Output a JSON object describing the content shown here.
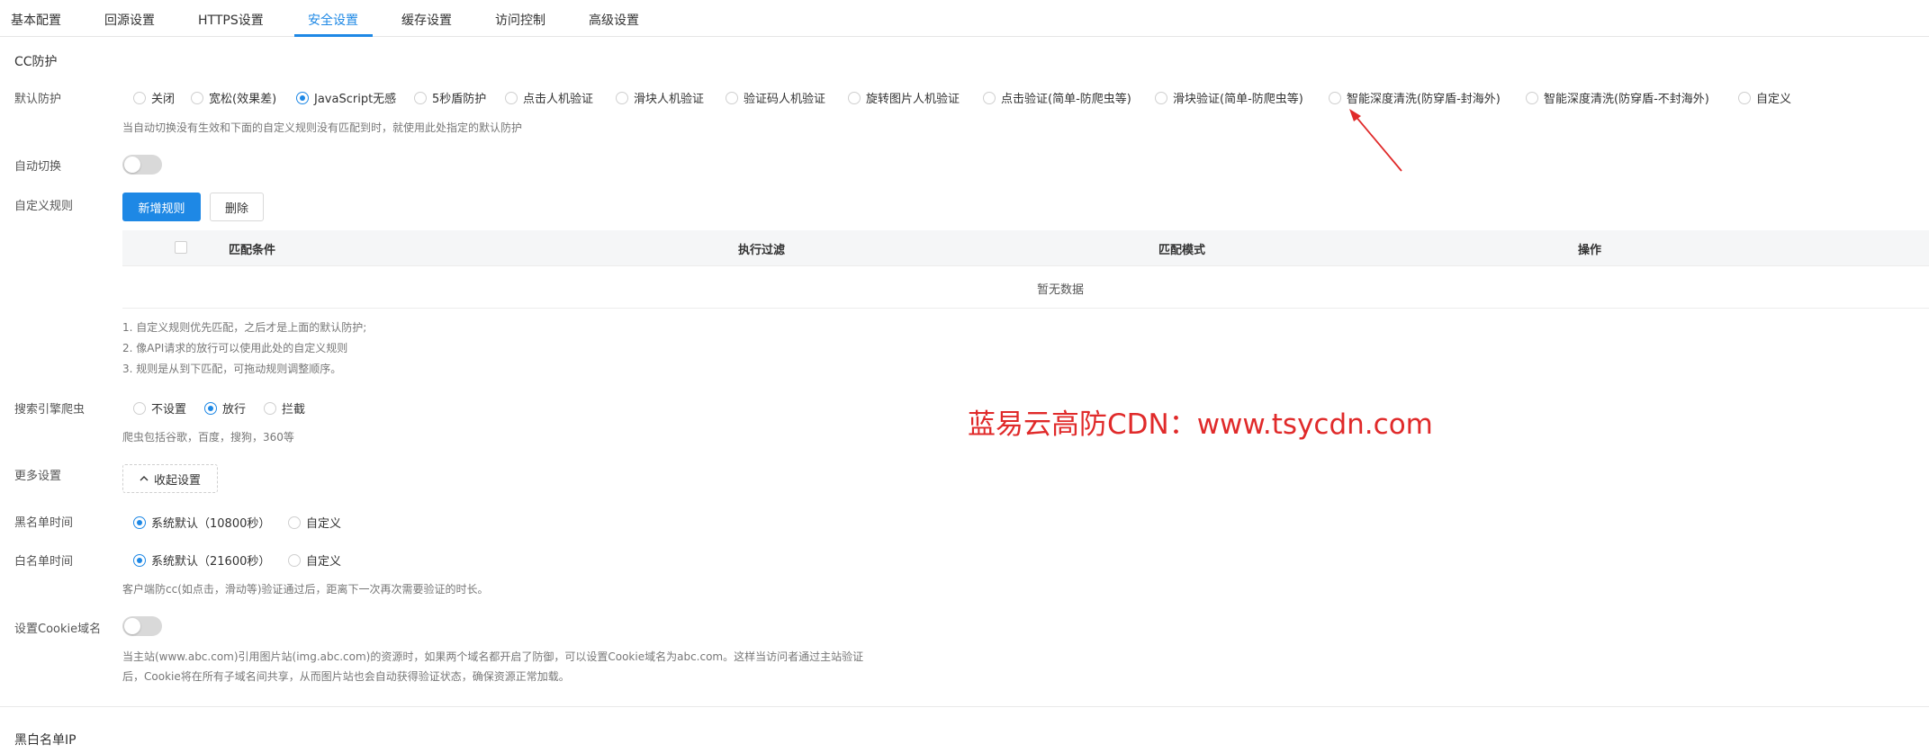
{
  "tabs": [
    "基本配置",
    "回源设置",
    "HTTPS设置",
    "安全设置",
    "缓存设置",
    "访问控制",
    "高级设置"
  ],
  "cc": {
    "title": "CC防护",
    "default_label": "默认防护",
    "default_options": [
      "关闭",
      "宽松(效果差)",
      "JavaScript无感",
      "5秒盾防护",
      "点击人机验证",
      "滑块人机验证",
      "验证码人机验证",
      "旋转图片人机验证",
      "点击验证(简单-防爬虫等)",
      "滑块验证(简单-防爬虫等)",
      "智能深度清洗(防穿盾-封海外)",
      "智能深度清洗(防穿盾-不封海外)",
      "自定义"
    ],
    "default_selected": "JavaScript无感",
    "default_help": "当自动切换没有生效和下面的自定义规则没有匹配到时，就使用此处指定的默认防护",
    "auto_switch_label": "自动切换",
    "custom_rules_label": "自定义规则",
    "add_rule_button": "新增规则",
    "delete_button": "删除",
    "table_headers": [
      "匹配条件",
      "执行过滤",
      "匹配模式",
      "操作"
    ],
    "table_empty": "暂无数据",
    "rules_notes": [
      "1. 自定义规则优先匹配，之后才是上面的默认防护;",
      "2. 像API请求的放行可以使用此处的自定义规则",
      "3. 规则是从到下匹配，可拖动规则调整顺序。"
    ],
    "crawler_label": "搜索引擎爬虫",
    "crawler_options": [
      "不设置",
      "放行",
      "拦截"
    ],
    "crawler_selected": "放行",
    "crawler_help": "爬虫包括谷歌，百度，搜狗，360等",
    "more_settings_label": "更多设置",
    "collapse_button": "收起设置",
    "blacklist_label": "黑名单时间",
    "blacklist_options": [
      "系统默认（10800秒）",
      "自定义"
    ],
    "whitelist_label": "白名单时间",
    "whitelist_options": [
      "系统默认（21600秒）",
      "自定义"
    ],
    "whitelist_help": "客户端防cc(如点击，滑动等)验证通过后，距离下一次再次需要验证的时长。",
    "cookie_label": "设置Cookie域名",
    "cookie_help_1": "当主站(www.abc.com)引用图片站(img.abc.com)的资源时，如果两个域名都开启了防御，可以设置Cookie域名为abc.com。这样当访问者通过主站验证",
    "cookie_help_2": "后，Cookie将在所有子域名间共享，从而图片站也会自动获得验证状态，确保资源正常加载。"
  },
  "blackwhite_title": "黑白名单IP",
  "watermark": "蓝易云高防CDN：www.tsycdn.com",
  "colors": {
    "accent": "#1e88e5",
    "watermark": "#e02a2a"
  }
}
